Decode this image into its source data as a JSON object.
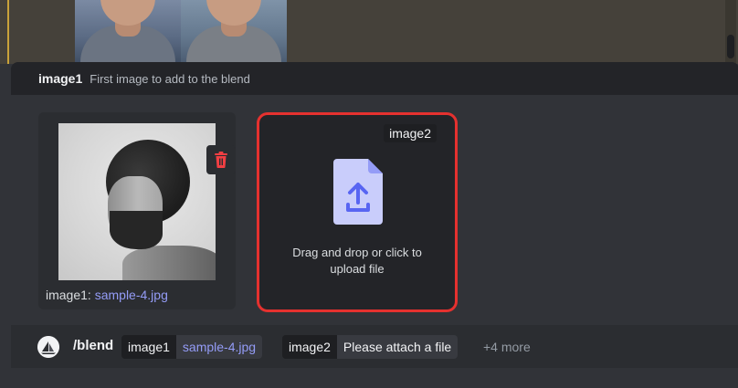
{
  "option_header": {
    "name": "image1",
    "description": "First image to add to the blend"
  },
  "attachment": {
    "option_label": "image1:",
    "filename": "sample-4.jpg"
  },
  "drop_zone": {
    "label": "image2",
    "text_line1": "Drag and drop or click to",
    "text_line2": "upload file"
  },
  "command_bar": {
    "command": "/blend",
    "options": [
      {
        "name": "image1",
        "value": "sample-4.jpg"
      },
      {
        "name": "image2",
        "value": "Please attach a file"
      }
    ],
    "more": "+4 more"
  },
  "colors": {
    "highlight_border": "#e5312f",
    "link_blue": "#949cf7",
    "delete_red": "#f23f43",
    "upload_icon": "#5865f2"
  },
  "icons": {
    "delete": "trash-icon",
    "upload": "file-upload-icon",
    "bot": "bot-avatar-icon"
  }
}
